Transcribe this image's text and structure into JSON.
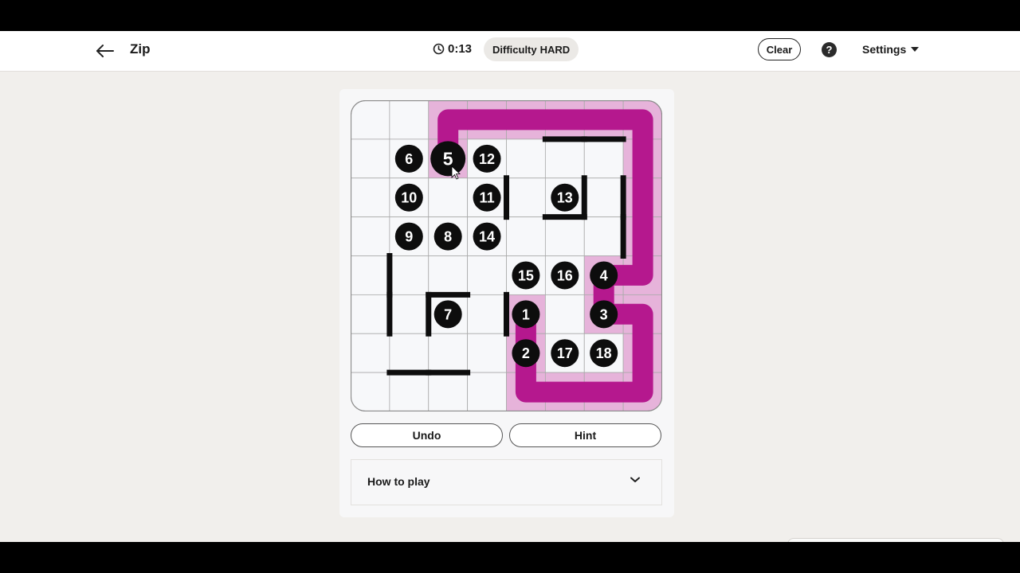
{
  "header": {
    "title": "Zip",
    "timer": "0:13",
    "difficulty_label": "Difficulty",
    "difficulty_value": "HARD",
    "clear_label": "Clear",
    "help_label": "?",
    "settings_label": "Settings"
  },
  "colors": {
    "path": "#b5188e",
    "path_fill": "#e6b3da",
    "dot": "#0d0d0d",
    "wall": "#0d0d0d",
    "cell": "#f7f8fa",
    "grid": "#a9a9a9"
  },
  "board": {
    "rows": 8,
    "cols": 8,
    "active_number": 5,
    "numbers": [
      {
        "value": "6",
        "row": 1,
        "col": 1
      },
      {
        "value": "5",
        "row": 1,
        "col": 2
      },
      {
        "value": "12",
        "row": 1,
        "col": 3
      },
      {
        "value": "10",
        "row": 2,
        "col": 1
      },
      {
        "value": "11",
        "row": 2,
        "col": 3
      },
      {
        "value": "13",
        "row": 2,
        "col": 5
      },
      {
        "value": "9",
        "row": 3,
        "col": 1
      },
      {
        "value": "8",
        "row": 3,
        "col": 2
      },
      {
        "value": "14",
        "row": 3,
        "col": 3
      },
      {
        "value": "15",
        "row": 4,
        "col": 4
      },
      {
        "value": "16",
        "row": 4,
        "col": 5
      },
      {
        "value": "4",
        "row": 4,
        "col": 6
      },
      {
        "value": "7",
        "row": 5,
        "col": 2
      },
      {
        "value": "1",
        "row": 5,
        "col": 4
      },
      {
        "value": "3",
        "row": 5,
        "col": 6
      },
      {
        "value": "2",
        "row": 6,
        "col": 4
      },
      {
        "value": "17",
        "row": 6,
        "col": 5
      },
      {
        "value": "18",
        "row": 6,
        "col": 6
      }
    ],
    "path": [
      [
        5,
        4
      ],
      [
        6,
        4
      ],
      [
        7,
        4
      ],
      [
        7,
        5
      ],
      [
        7,
        6
      ],
      [
        7,
        7
      ],
      [
        6,
        7
      ],
      [
        5,
        7
      ],
      [
        5,
        6
      ],
      [
        4,
        6
      ],
      [
        4,
        7
      ],
      [
        3,
        7
      ],
      [
        2,
        7
      ],
      [
        1,
        7
      ],
      [
        0,
        7
      ],
      [
        0,
        6
      ],
      [
        0,
        5
      ],
      [
        0,
        4
      ],
      [
        0,
        3
      ],
      [
        0,
        2
      ],
      [
        1,
        2
      ]
    ],
    "walls": [
      {
        "side": "top",
        "row": 1,
        "col": 5
      },
      {
        "side": "top",
        "row": 1,
        "col": 6
      },
      {
        "side": "left",
        "row": 2,
        "col": 4
      },
      {
        "side": "right",
        "row": 2,
        "col": 5
      },
      {
        "side": "bottom",
        "row": 2,
        "col": 5
      },
      {
        "side": "left",
        "row": 2,
        "col": 7
      },
      {
        "side": "left",
        "row": 3,
        "col": 7
      },
      {
        "side": "left",
        "row": 4,
        "col": 1
      },
      {
        "side": "left",
        "row": 5,
        "col": 1
      },
      {
        "side": "top",
        "row": 5,
        "col": 2
      },
      {
        "side": "left",
        "row": 5,
        "col": 2
      },
      {
        "side": "left",
        "row": 5,
        "col": 4
      },
      {
        "side": "bottom",
        "row": 6,
        "col": 1
      },
      {
        "side": "bottom",
        "row": 6,
        "col": 2
      }
    ]
  },
  "controls": {
    "undo_label": "Undo",
    "hint_label": "Hint"
  },
  "how_to_play": {
    "label": "How to play"
  },
  "icons": {
    "back": "arrow-left-icon",
    "timer": "clock-icon",
    "help": "question-mark-icon",
    "settings": "caret-down-icon",
    "howto": "chevron-down-icon"
  }
}
